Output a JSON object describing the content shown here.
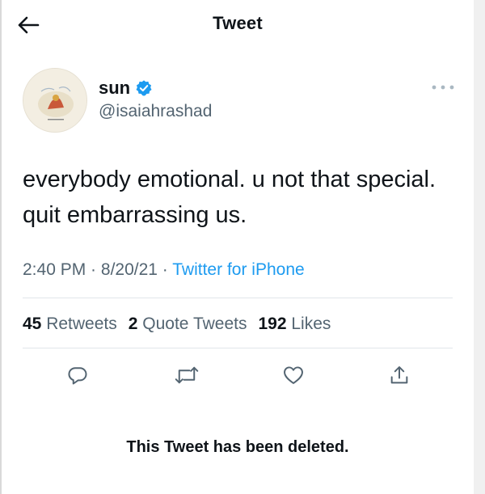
{
  "header": {
    "title": "Tweet"
  },
  "author": {
    "display_name": "sun",
    "handle": "@isaiahrashad",
    "verified": true
  },
  "tweet": {
    "text": "everybody emotional. u not that special. quit embarrassing us.",
    "time": "2:40 PM",
    "date": "8/20/21",
    "separator": " · ",
    "source": "Twitter for iPhone"
  },
  "stats": {
    "retweets_count": "45",
    "retweets_label": "Retweets",
    "quotes_count": "2",
    "quotes_label": "Quote Tweets",
    "likes_count": "192",
    "likes_label": "Likes"
  },
  "notice": {
    "deleted": "This Tweet has been deleted."
  },
  "colors": {
    "accent": "#1d9bf0",
    "muted": "#536471",
    "text": "#0f1419"
  },
  "icons": [
    "back-arrow-icon",
    "verified-badge-icon",
    "more-icon",
    "reply-icon",
    "retweet-icon",
    "like-icon",
    "share-icon"
  ]
}
